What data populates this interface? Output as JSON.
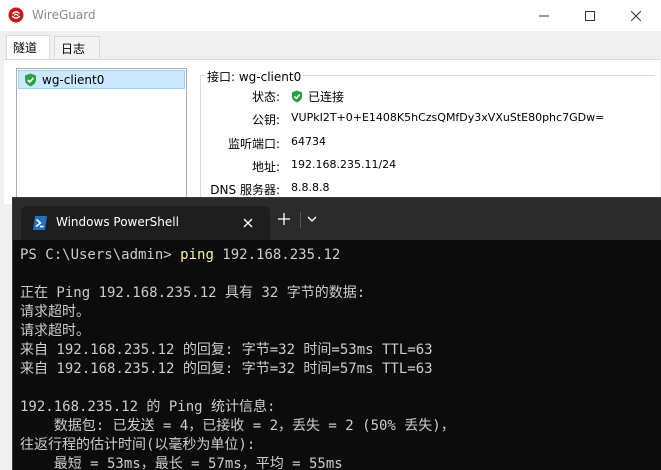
{
  "wireguard": {
    "title": "WireGuard",
    "tabs": [
      {
        "label": "隧道"
      },
      {
        "label": "日志"
      }
    ],
    "tunnels": [
      {
        "name": "wg-client0",
        "status": "active"
      }
    ],
    "interface": {
      "legend": "接口: wg-client0",
      "status_label": "状态:",
      "status_value": "已连接",
      "pubkey_label": "公钥:",
      "pubkey_value": "VUPkI2T+0+E1408K5hCzsQMfDy3xVXuStE80phc7GDw=",
      "port_label": "监听端口:",
      "port_value": "64734",
      "addr_label": "地址:",
      "addr_value": "192.168.235.11/24",
      "dns_label": "DNS 服务器:",
      "dns_value": "8.8.8.8"
    },
    "colors": {
      "accent": "#c51a1b",
      "status_ok": "#2ea043",
      "selection": "#cce8ff"
    }
  },
  "powershell": {
    "tab_title": "Windows PowerShell",
    "prompt": "PS C:\\Users\\admin> ",
    "command": "ping",
    "command_args": " 192.168.235.12",
    "output": [
      "",
      "正在 Ping 192.168.235.12 具有 32 字节的数据:",
      "请求超时。",
      "请求超时。",
      "来自 192.168.235.12 的回复: 字节=32 时间=53ms TTL=63",
      "来自 192.168.235.12 的回复: 字节=32 时间=57ms TTL=63",
      "",
      "192.168.235.12 的 Ping 统计信息:",
      "    数据包: 已发送 = 4，已接收 = 2，丢失 = 2 (50% 丢失)，",
      "往返行程的估计时间(以毫秒为单位):",
      "    最短 = 53ms，最长 = 57ms，平均 = 55ms"
    ]
  }
}
